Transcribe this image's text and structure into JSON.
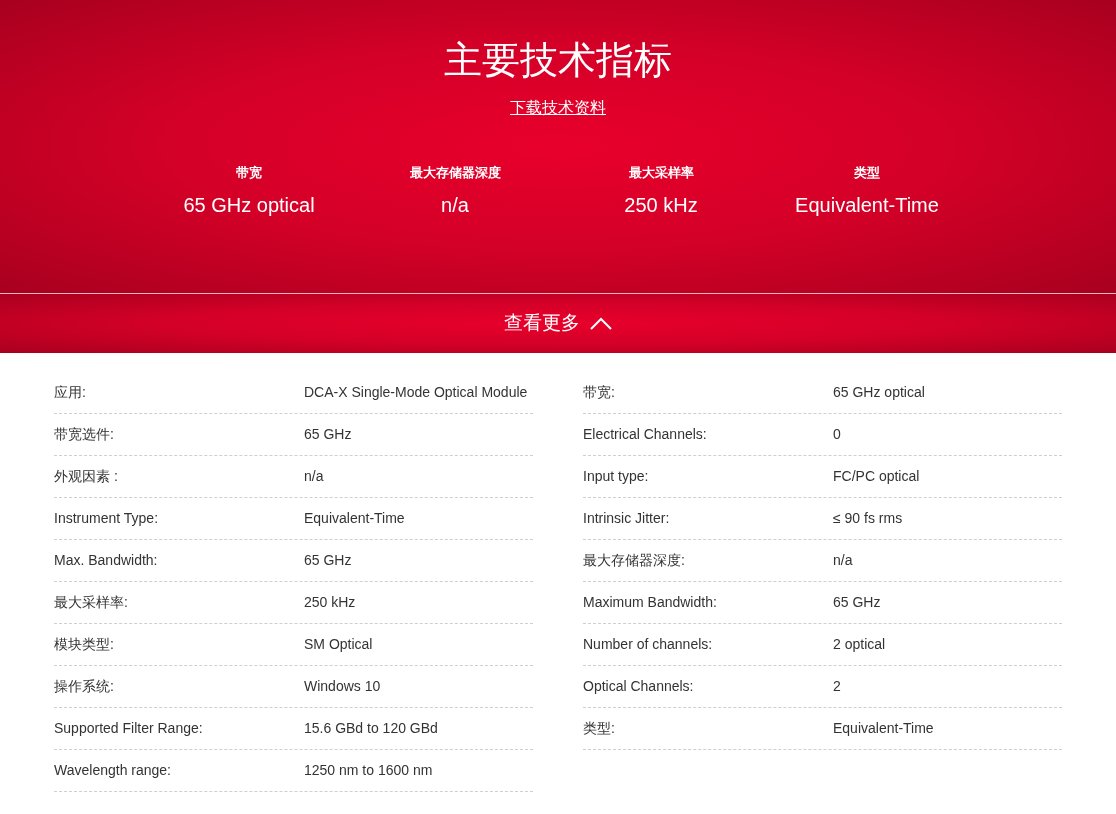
{
  "hero": {
    "title": "主要技术指标",
    "download_link": "下载技术资料",
    "highlights": [
      {
        "label": "带宽",
        "value": "65 GHz optical"
      },
      {
        "label": "最大存储器深度",
        "value": "n/a"
      },
      {
        "label": "最大采样率",
        "value": "250 kHz"
      },
      {
        "label": "类型",
        "value": "Equivalent-Time"
      }
    ]
  },
  "toggle": {
    "label": "查看更多",
    "expanded": true
  },
  "specs": {
    "left": [
      {
        "label": "应用:",
        "value": "DCA-X Single-Mode Optical Module"
      },
      {
        "label": "带宽选件:",
        "value": "65 GHz"
      },
      {
        "label": "外观因素 :",
        "value": "n/a"
      },
      {
        "label": "Instrument Type:",
        "value": "Equivalent-Time"
      },
      {
        "label": "Max. Bandwidth:",
        "value": "65 GHz"
      },
      {
        "label": "最大采样率:",
        "value": "250 kHz"
      },
      {
        "label": "模块类型:",
        "value": "SM Optical"
      },
      {
        "label": "操作系统:",
        "value": "Windows 10"
      },
      {
        "label": "Supported Filter Range:",
        "value": "15.6 GBd to 120 GBd"
      },
      {
        "label": "Wavelength range:",
        "value": "1250 nm to 1600 nm"
      }
    ],
    "right": [
      {
        "label": "带宽:",
        "value": "65 GHz optical"
      },
      {
        "label": "Electrical Channels:",
        "value": "0"
      },
      {
        "label": "Input type:",
        "value": "FC/PC optical"
      },
      {
        "label": "Intrinsic Jitter:",
        "value": "≤ 90 fs rms"
      },
      {
        "label": "最大存储器深度:",
        "value": "n/a"
      },
      {
        "label": "Maximum Bandwidth:",
        "value": "65 GHz"
      },
      {
        "label": "Number of channels:",
        "value": "2 optical"
      },
      {
        "label": "Optical Channels:",
        "value": "2"
      },
      {
        "label": "类型:",
        "value": "Equivalent-Time"
      }
    ]
  }
}
